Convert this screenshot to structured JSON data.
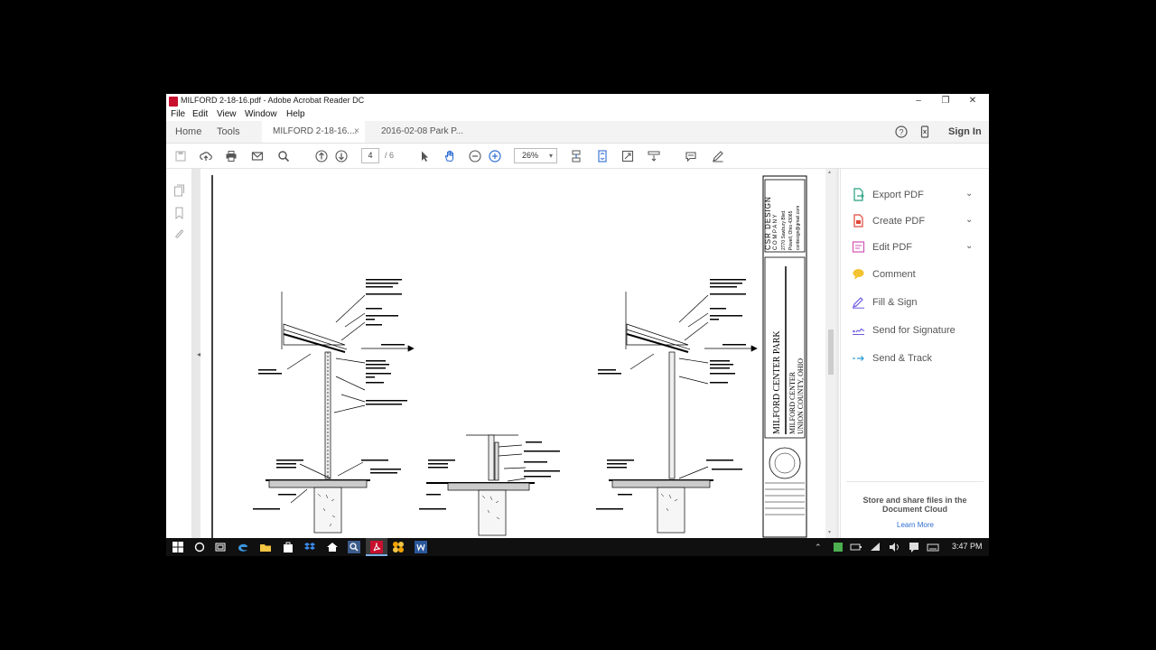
{
  "window": {
    "title": "MILFORD 2-18-16.pdf - Adobe Acrobat Reader DC",
    "minimize": "–",
    "maximize": "❐",
    "close": "✕"
  },
  "menu": [
    "File",
    "Edit",
    "View",
    "Window",
    "Help"
  ],
  "tabs": {
    "home": "Home",
    "tools": "Tools",
    "doc1": "MILFORD 2-18-16....",
    "doc1_close": "×",
    "doc2": "2016-02-08 Park P...",
    "sign_in": "Sign In"
  },
  "toolbar": {
    "page_current": "4",
    "page_total": "/  6",
    "zoom": "26%"
  },
  "drawing": {
    "title_block_company": "CSR DESIGN",
    "title_block_company_sub": "C O M P A N Y",
    "title_block_address": [
      "2770 Sawbury Blvd.",
      "Powell, Ohio 43065",
      "csrdesign@gmail.com"
    ],
    "project_title": "MILFORD CENTER PARK",
    "project_sub1": "MILFORD CENTER",
    "project_sub2": "UNION COUNTY, OHIO"
  },
  "right_panel": {
    "items": [
      {
        "label": "Export PDF",
        "icon": "export-pdf-icon",
        "color": "#25a07f",
        "expand": true
      },
      {
        "label": "Create PDF",
        "icon": "create-pdf-icon",
        "color": "#e0473b",
        "expand": true
      },
      {
        "label": "Edit PDF",
        "icon": "edit-pdf-icon",
        "color": "#d653b5",
        "expand": true
      },
      {
        "label": "Comment",
        "icon": "comment-icon",
        "color": "#f2c230",
        "expand": false
      },
      {
        "label": "Fill & Sign",
        "icon": "fill-sign-icon",
        "color": "#6b5ae0",
        "expand": false
      },
      {
        "label": "Send for Signature",
        "icon": "send-signature-icon",
        "color": "#6b5ae0",
        "expand": false
      },
      {
        "label": "Send & Track",
        "icon": "send-track-icon",
        "color": "#2d9fd3",
        "expand": false
      }
    ],
    "store_text": "Store and share files in the Document Cloud",
    "learn_more": "Learn More"
  },
  "taskbar": {
    "clock": "3:47 PM"
  }
}
